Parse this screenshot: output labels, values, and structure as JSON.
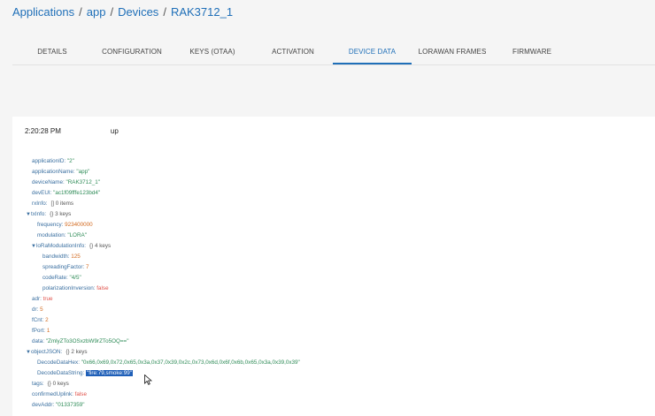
{
  "breadcrumb": {
    "items": [
      "Applications",
      "app",
      "Devices",
      "RAK3712_1"
    ],
    "separator": "/"
  },
  "tabs": [
    {
      "label": "DETAILS",
      "active": false
    },
    {
      "label": "CONFIGURATION",
      "active": false
    },
    {
      "label": "KEYS (OTAA)",
      "active": false
    },
    {
      "label": "ACTIVATION",
      "active": false
    },
    {
      "label": "DEVICE DATA",
      "active": true
    },
    {
      "label": "LORAWAN FRAMES",
      "active": false
    },
    {
      "label": "FIRMWARE",
      "active": false
    }
  ],
  "event": {
    "time": "2:20:28 PM",
    "type": "up"
  },
  "tree": {
    "applicationID": "\"2\"",
    "applicationName": "\"app\"",
    "deviceName": "\"RAK3712_1\"",
    "devEUI": "\"ac1f09fffe123bd4\"",
    "rxInfo_meta": "[] 0 items",
    "txInfo_meta": "{} 3 keys",
    "frequency": "923400000",
    "modulation": "\"LORA\"",
    "loRaModulationInfo_meta": "{} 4 keys",
    "bandwidth": "125",
    "spreadingFactor": "7",
    "codeRate": "\"4/5\"",
    "polarizationInversion": "false",
    "adr": "true",
    "dr": "5",
    "fCnt": "2",
    "fPort": "1",
    "data": "\"ZmlyZTo3OSxzbW9rZTo5OQ==\"",
    "objectJSON_meta": "{} 2 keys",
    "DecodeDataHex": "\"0x66,0x69,0x72,0x65,0x3a,0x37,0x39,0x2c,0x73,0x6d,0x6f,0x6b,0x65,0x3a,0x39,0x39\"",
    "DecodeDataString": "\"fire:79,smoke:99\"",
    "tags_meta": "{} 0 keys",
    "confirmedUplink": "false",
    "devAddr": "\"01337359\""
  },
  "keys": {
    "applicationID": "applicationID:",
    "applicationName": "applicationName:",
    "deviceName": "deviceName:",
    "devEUI": "devEUI:",
    "rxInfo": "rxInfo:",
    "txInfo": "txInfo:",
    "frequency": "frequency:",
    "modulation": "modulation:",
    "loRaModulationInfo": "loRaModulationInfo:",
    "bandwidth": "bandwidth:",
    "spreadingFactor": "spreadingFactor:",
    "codeRate": "codeRate:",
    "polarizationInversion": "polarizationInversion:",
    "adr": "adr:",
    "dr": "dr:",
    "fCnt": "fCnt:",
    "fPort": "fPort:",
    "data": "data:",
    "objectJSON": "objectJSON:",
    "DecodeDataHex": "DecodeDataHex:",
    "DecodeDataString": "DecodeDataString:",
    "tags": "tags:",
    "confirmedUplink": "confirmedUplink:",
    "devAddr": "devAddr:"
  },
  "colors": {
    "accent": "#1f6fb8",
    "string": "#2e8b57",
    "number": "#d2691e",
    "boolean": "#e0524b",
    "selection": "#1f5fb8"
  },
  "icons": {
    "expand": "triangle-down-icon",
    "cursor": "mouse-pointer-icon"
  }
}
